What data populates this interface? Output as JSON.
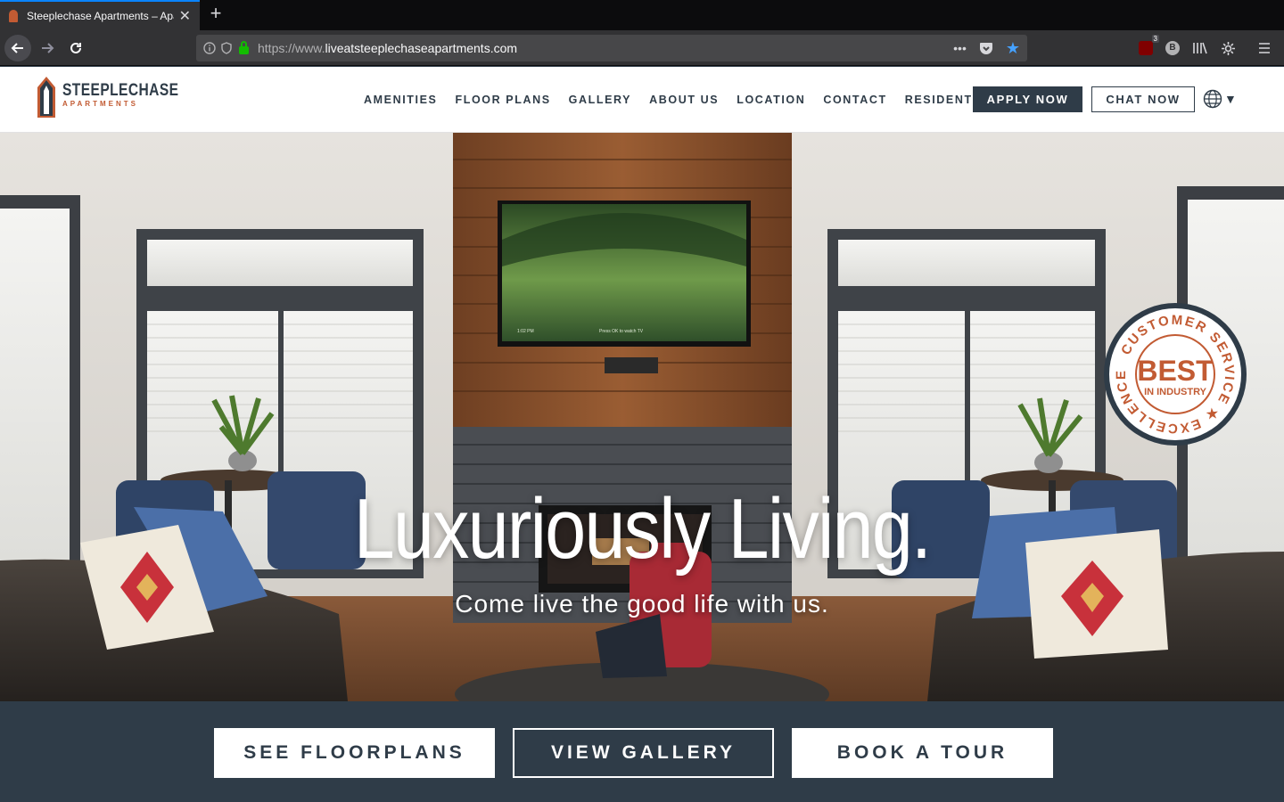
{
  "browser": {
    "tab_title": "Steeplechase Apartments – Apartments",
    "tab_close": "✕",
    "new_tab": "+",
    "url_prefix": "https://www.",
    "url_domain": "liveatsteeplechaseapartments.com",
    "page_actions": "•••",
    "extension_badge": "3",
    "extension_b": "B"
  },
  "header": {
    "logo_name": "STEEPLECHASE",
    "logo_sub": "APARTMENTS",
    "nav": [
      "AMENITIES",
      "FLOOR PLANS",
      "GALLERY",
      "ABOUT US",
      "LOCATION",
      "CONTACT",
      "RESIDENT PORTAL"
    ],
    "apply_label": "APPLY NOW",
    "chat_label": "CHAT NOW",
    "lang_caret": "▼"
  },
  "hero": {
    "title": "Luxuriously Living.",
    "subtitle": "Come live the good life with us.",
    "tv_time": "1:02 PM",
    "tv_caption": "Press OK to watch TV",
    "seal": {
      "ring_text": "CUSTOMER SERVICE ★ EXCELLENCE ★",
      "main": "BEST",
      "sub": "IN INDUSTRY"
    }
  },
  "cta": {
    "floorplans": "SEE FLOORPLANS",
    "gallery": "VIEW GALLERY",
    "tour": "BOOK A TOUR"
  },
  "colors": {
    "brand_navy": "#2f3c48",
    "brand_rust": "#c25b33",
    "firefox_blue": "#0a84ff"
  }
}
